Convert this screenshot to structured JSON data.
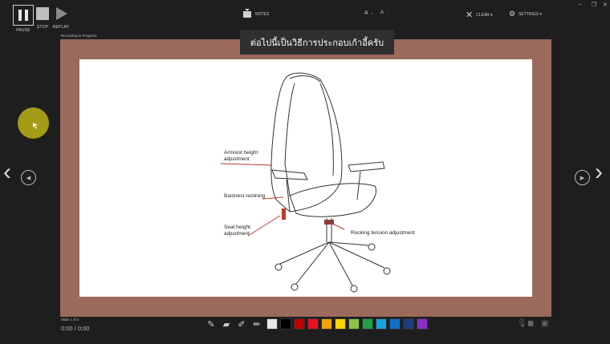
{
  "toolbar": {
    "pause_label": "PAUSE",
    "stop_label": "STOP",
    "replay_label": "REPLAY",
    "notes_label": "NOTES",
    "font_increase": "A",
    "font_decrease": "A",
    "clear_label": "CLEAR ▾",
    "settings_label": "SETTINGS ▾"
  },
  "window": {
    "minimize": "–",
    "restore": "❐",
    "close": "✕"
  },
  "status": {
    "recording": "Recording in Progress"
  },
  "subtitle": "ต่อไปนี้เป็นวิธีการประกอบเก้าอี้ครับ",
  "slide": {
    "labels": {
      "armrest": [
        "Armrest height",
        "adjustment"
      ],
      "backrest": "Backrest reclining",
      "seat": [
        "Seat height",
        "adjustment"
      ],
      "rocking": "Rocking tension adjustment"
    }
  },
  "footer": {
    "slide_count": "Slide 1 of 2",
    "timer": "0:00  /  0:00"
  },
  "pens": [
    "pen-icon",
    "eraser-icon",
    "highlighter-icon",
    "marker-icon"
  ],
  "colors": [
    "#e6e6e6",
    "#000000",
    "#c00000",
    "#e81123",
    "#f0a30a",
    "#ffd400",
    "#8bc34a",
    "#21a147",
    "#19a3e0",
    "#0f6fc6",
    "#1f3d7a",
    "#8b2fc9"
  ],
  "icons": {
    "pause": "pause-icon",
    "stop": "stop-icon",
    "replay": "play-icon",
    "notes": "notes-icon",
    "clear": "clear-icon",
    "settings": "settings-icon",
    "mic": "microphone-icon",
    "camera": "camera-icon",
    "camera_preview": "camera-preview-icon"
  }
}
